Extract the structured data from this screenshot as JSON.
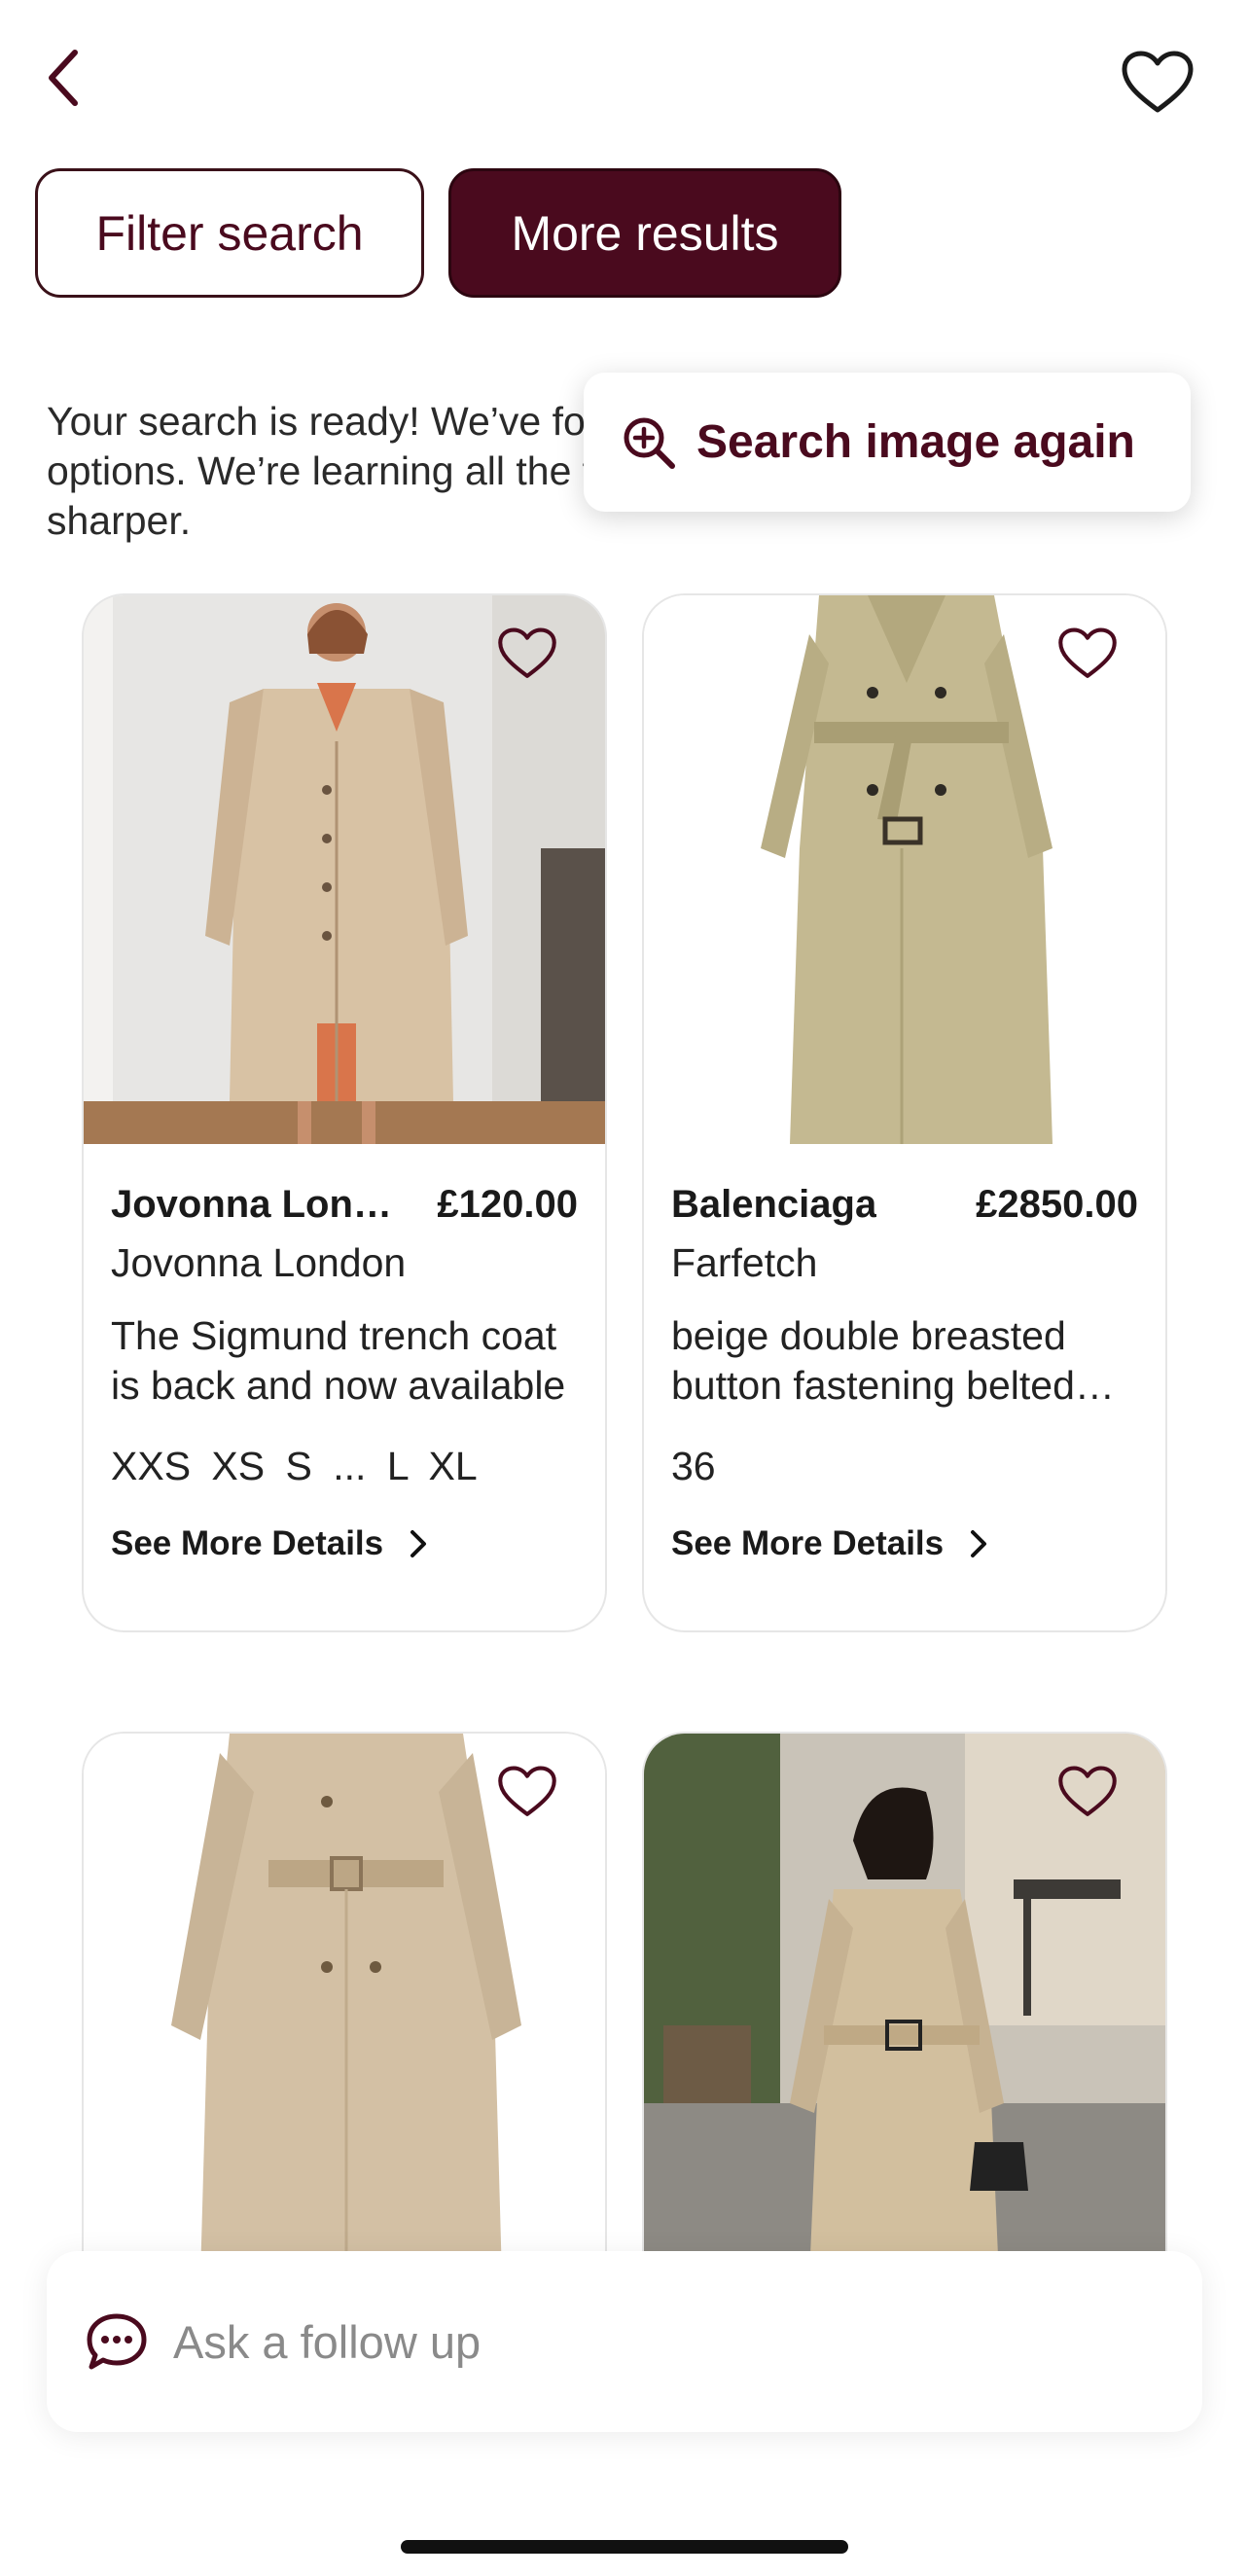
{
  "header": {
    "back_icon": "chevron-left-icon",
    "favorite_icon": "heart-outline-icon"
  },
  "actions": {
    "filter_label": "Filter search",
    "more_results_label": "More results"
  },
  "intro_text": "Your search is ready! We’ve found your image, plus a few other options. We’re learning all the time, so things will only get sharper.",
  "search_again": {
    "label": "Search image again",
    "icon": "zoom-in-icon"
  },
  "products": [
    {
      "brand": "Jovonna London",
      "price": "£120.00",
      "store": "Jovonna London",
      "description": "The Sigmund trench coat is back and now available",
      "sizes": "XXS  XS  S  ...  L  XL",
      "details_label": "See More Details"
    },
    {
      "brand": "Balenciaga",
      "price": "£2850.00",
      "store": "Farfetch",
      "description": "beige double breasted button fastening belted waist",
      "sizes": "36",
      "details_label": "See More Details"
    },
    {},
    {}
  ],
  "followup": {
    "placeholder": "Ask a follow up",
    "icon": "chat-bubble-icon"
  },
  "colors": {
    "accent": "#4a0a1e",
    "card_border": "#e6e6e6",
    "coat_beige": "#d8c2a4",
    "coat_olive": "#c4b991"
  }
}
